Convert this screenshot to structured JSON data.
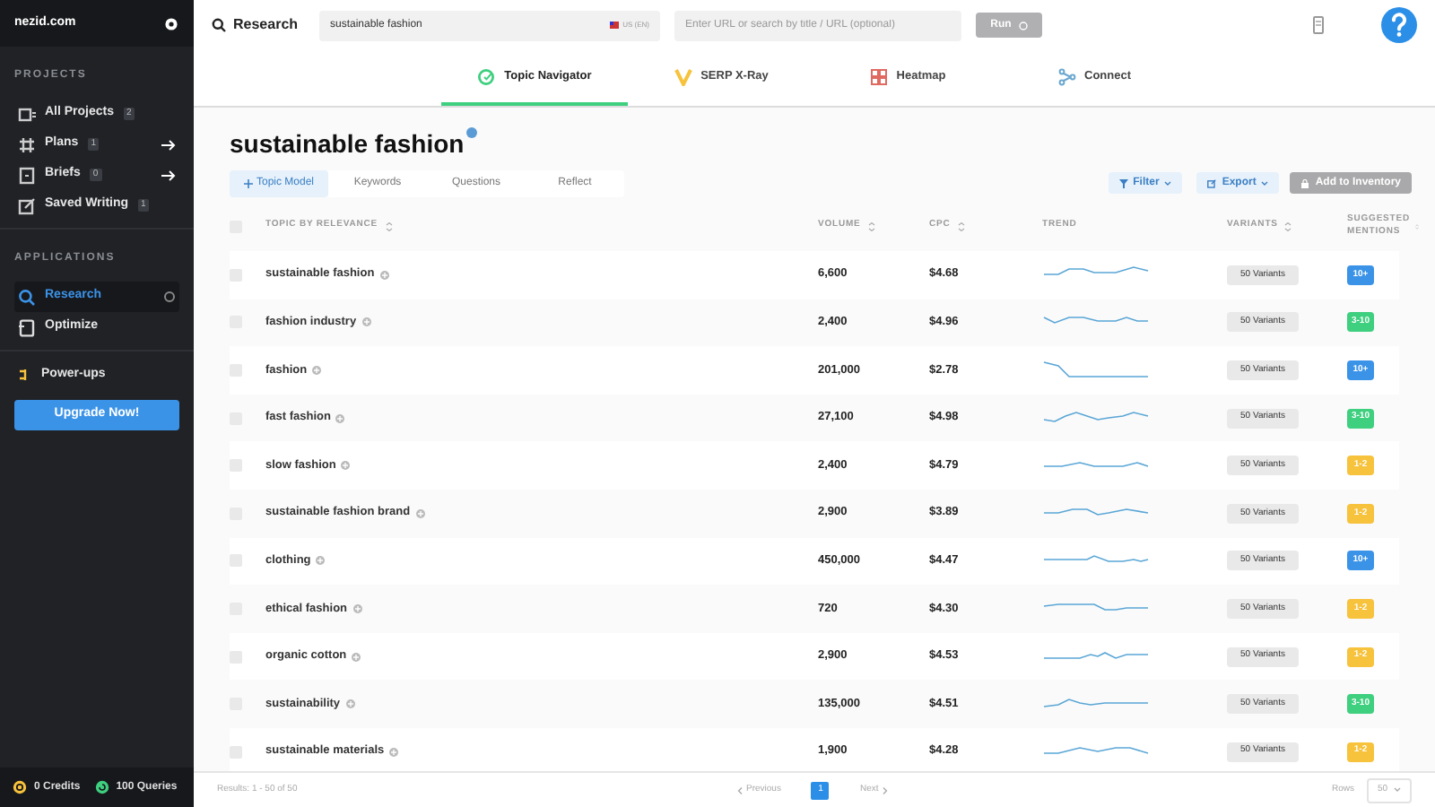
{
  "sidebar": {
    "account": "nezid.com",
    "sections": [
      {
        "heading": "PROJECTS",
        "items": [
          {
            "label": "All Projects",
            "count": "2",
            "arrow": false,
            "selected": false
          },
          {
            "label": "Plans",
            "count": "1",
            "arrow": true,
            "selected": false
          },
          {
            "label": "Briefs",
            "count": "0",
            "arrow": true,
            "selected": false
          },
          {
            "label": "Saved Writing",
            "count": "1",
            "arrow": false,
            "selected": false
          }
        ]
      },
      {
        "heading": "APPLICATIONS",
        "items": [
          {
            "label": "Research",
            "arrow": false,
            "selected": true
          },
          {
            "label": "Optimize",
            "arrow": false,
            "selected": false
          }
        ]
      }
    ],
    "powerups": "Power-ups",
    "upgrade": "Upgrade Now!",
    "credits": "0 Credits",
    "queries": "100 Queries"
  },
  "topbar": {
    "app": "Research",
    "query": "sustainable fashion",
    "locale": "US (EN)",
    "url_placeholder": "Enter URL or search by title / URL (optional)",
    "run": "Run"
  },
  "nav_tabs": [
    {
      "label": "Topic Navigator",
      "selected": true
    },
    {
      "label": "SERP X-Ray",
      "selected": false
    },
    {
      "label": "Heatmap",
      "selected": false
    },
    {
      "label": "Connect",
      "selected": false
    }
  ],
  "title": "sustainable fashion",
  "sub_tabs": [
    {
      "label": "Topic Model",
      "selected": true
    },
    {
      "label": "Keywords",
      "selected": false
    },
    {
      "label": "Questions",
      "selected": false
    },
    {
      "label": "Reflect",
      "selected": false
    }
  ],
  "actions": {
    "filter": "Filter",
    "export": "Export",
    "add": "Add to Inventory"
  },
  "table": {
    "all_checked": false,
    "columns": [
      "TOPIC BY RELEVANCE",
      "VOLUME",
      "CPC",
      "TREND",
      "VARIANTS",
      "SUGGESTED MENTIONS"
    ],
    "rows": [
      {
        "checked": false,
        "topic": "sustainable fashion",
        "volume": "6,600",
        "cpc": "$4.68",
        "variants": "50 Variants",
        "mentions": "10+",
        "color": "#3b93e8"
      },
      {
        "checked": false,
        "topic": "fashion industry",
        "volume": "2,400",
        "cpc": "$4.96",
        "variants": "50 Variants",
        "mentions": "3-10",
        "color": "#3ecf7f"
      },
      {
        "checked": false,
        "topic": "fashion",
        "volume": "201,000",
        "cpc": "$2.78",
        "variants": "50 Variants",
        "mentions": "10+",
        "color": "#3b93e8"
      },
      {
        "checked": false,
        "topic": "fast fashion",
        "volume": "27,100",
        "cpc": "$4.98",
        "variants": "50 Variants",
        "mentions": "3-10",
        "color": "#3ecf7f"
      },
      {
        "checked": false,
        "topic": "slow fashion",
        "volume": "2,400",
        "cpc": "$4.79",
        "variants": "50 Variants",
        "mentions": "1-2",
        "color": "#f7c23c"
      },
      {
        "checked": false,
        "topic": "sustainable fashion brand",
        "volume": "2,900",
        "cpc": "$3.89",
        "variants": "50 Variants",
        "mentions": "1-2",
        "color": "#f7c23c"
      },
      {
        "checked": false,
        "topic": "clothing",
        "volume": "450,000",
        "cpc": "$4.47",
        "variants": "50 Variants",
        "mentions": "10+",
        "color": "#3b93e8"
      },
      {
        "checked": false,
        "topic": "ethical fashion",
        "volume": "720",
        "cpc": "$4.30",
        "variants": "50 Variants",
        "mentions": "1-2",
        "color": "#f7c23c"
      },
      {
        "checked": false,
        "topic": "organic cotton",
        "volume": "2,900",
        "cpc": "$4.53",
        "variants": "50 Variants",
        "mentions": "1-2",
        "color": "#f7c23c"
      },
      {
        "checked": false,
        "topic": "sustainability",
        "volume": "135,000",
        "cpc": "$4.51",
        "variants": "50 Variants",
        "mentions": "3-10",
        "color": "#3ecf7f"
      },
      {
        "checked": false,
        "topic": "sustainable materials",
        "volume": "1,900",
        "cpc": "$4.28",
        "variants": "50 Variants",
        "mentions": "1-2",
        "color": "#f7c23c"
      }
    ]
  },
  "footer": {
    "results": "Results: 1 - 50 of 50",
    "previous": "Previous",
    "page": "1",
    "next": "Next",
    "rows_label": "Rows",
    "rows_value": "50"
  }
}
